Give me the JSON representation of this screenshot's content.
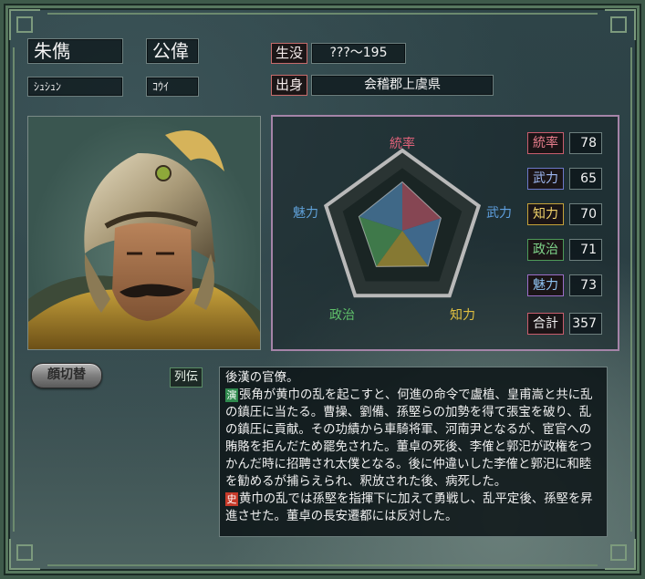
{
  "general": {
    "name": "朱儁",
    "courtesy_name": "公偉",
    "name_reading": "ｼｭｼｭﾝ",
    "courtesy_reading": "ｺｳｲ"
  },
  "life": {
    "label": "生没",
    "value": "???～195"
  },
  "birthplace": {
    "label": "出身",
    "value": "会稽郡上虞県"
  },
  "radar": {
    "axes": [
      "統率",
      "武力",
      "知力",
      "政治",
      "魅力"
    ],
    "axis_colors": [
      "#e0627a",
      "#5fa0e0",
      "#e0c040",
      "#5fbf6a",
      "#5fa0d8"
    ],
    "max": 100
  },
  "stats": [
    {
      "label": "統率",
      "value": "78",
      "value_num": 78,
      "color": "#e77d8c",
      "border": "#c95d6d"
    },
    {
      "label": "武力",
      "value": "65",
      "value_num": 65,
      "color": "#9fb8f2",
      "border": "#6c78c8"
    },
    {
      "label": "知力",
      "value": "70",
      "value_num": 70,
      "color": "#f2d36a",
      "border": "#c6a33a"
    },
    {
      "label": "政治",
      "value": "71",
      "value_num": 71,
      "color": "#7fd48a",
      "border": "#4e9a58"
    },
    {
      "label": "魅力",
      "value": "73",
      "value_num": 73,
      "color": "#8fc4f2",
      "border": "#9c6ec8"
    }
  ],
  "total": {
    "label": "合計",
    "value": "357"
  },
  "face_button": {
    "label": "顔切替"
  },
  "retsuden": {
    "label": "列伝",
    "intro": "後漢の官僚。",
    "engi_marker": "演",
    "engi_text": "張角が黄巾の乱を起こすと、何進の命令で盧植、皇甫嵩と共に乱の鎮圧に当たる。曹操、劉備、孫堅らの加勢を得て張宝を破り、乱の鎮圧に貢献。その功績から車騎将軍、河南尹となるが、宦官への賄賂を拒んだため罷免された。董卓の死後、李傕と郭汜が政権をつかんだ時に招聘され太僕となる。後に仲違いした李傕と郭汜に和睦を勧めるが捕らえられ、釈放された後、病死した。",
    "shi_marker": "史",
    "shi_text": "黄巾の乱では孫堅を指揮下に加えて勇戦し、乱平定後、孫堅を昇進させた。董卓の長安遷都には反対した。"
  }
}
